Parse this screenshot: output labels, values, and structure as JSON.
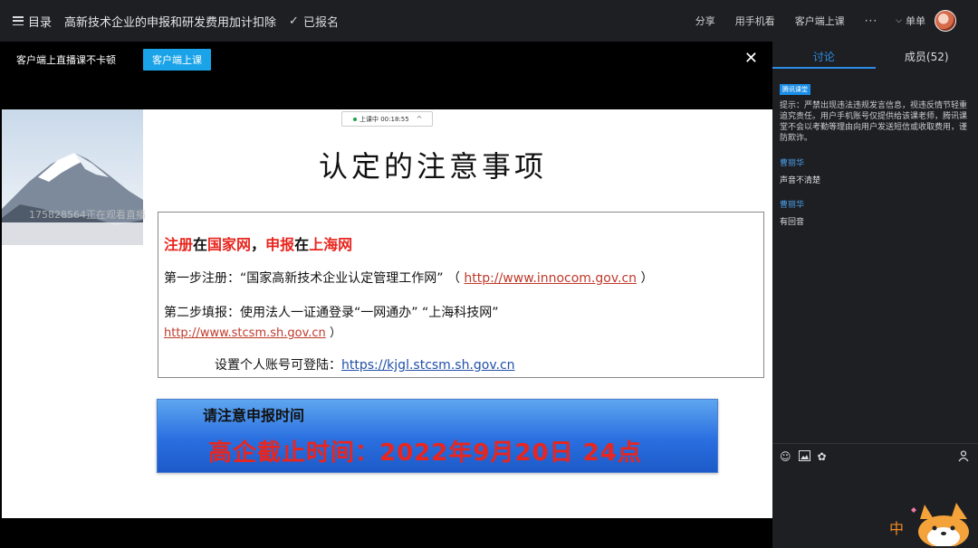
{
  "topbar": {
    "menu_label": "目录",
    "course_title": "高新技术企业的申报和研发费用加计扣除",
    "enrolled_label": "已报名",
    "share": "分享",
    "mobile_view": "用手机看",
    "client_class": "客户端上课",
    "more": "···",
    "single": "单单"
  },
  "notice": {
    "text": "客户端上直播课不卡顿",
    "button": "客户端上课"
  },
  "slide": {
    "watermark": "175828564正在观看直播",
    "live_status": "上课中 00:18:55",
    "title": "认定的注意事项",
    "line1": {
      "a": "注册",
      "b": "在",
      "c": "国家网",
      "d": "，",
      "e": "申报",
      "f": "在",
      "g": "上海网"
    },
    "line2_text": "第一步注册：“国家高新技术企业认定管理工作网” （",
    "line2_link": "http://www.innocom.gov.cn",
    "line2_end": "）",
    "line3_text": "第二步填报：使用法人一证通登录“一网通办” “上海科技网”",
    "line3_link": "http://www.stcsm.sh.gov.cn",
    "line3_end": "）",
    "line4_text": "设置个人账号可登陆：",
    "line4_link": "https://kjgl.stcsm.sh.gov.cn",
    "banner_label": "请注意申报时间",
    "banner_deadline": "高企截止时间：2022年9月20日 24点"
  },
  "panel": {
    "tab_discuss": "讨论",
    "tab_members": "成员(52)",
    "tag": "腾讯课堂",
    "system_msg": "提示：严禁出现违法违规发言信息，视违反情节轻重追究责任。用户手机账号仅提供给该课老师，腾讯课堂不会以考勤等理由向用户发送短信或收取费用，谨防欺诈。",
    "messages": [
      {
        "name": "曹丽华",
        "text": "声音不清楚"
      },
      {
        "name": "曹丽华",
        "text": "有回音"
      }
    ],
    "sticker_text": "中"
  },
  "colors": {
    "accent": "#2b8de6",
    "highlight_red": "#e8261f",
    "button_blue": "#1aa3e8"
  }
}
